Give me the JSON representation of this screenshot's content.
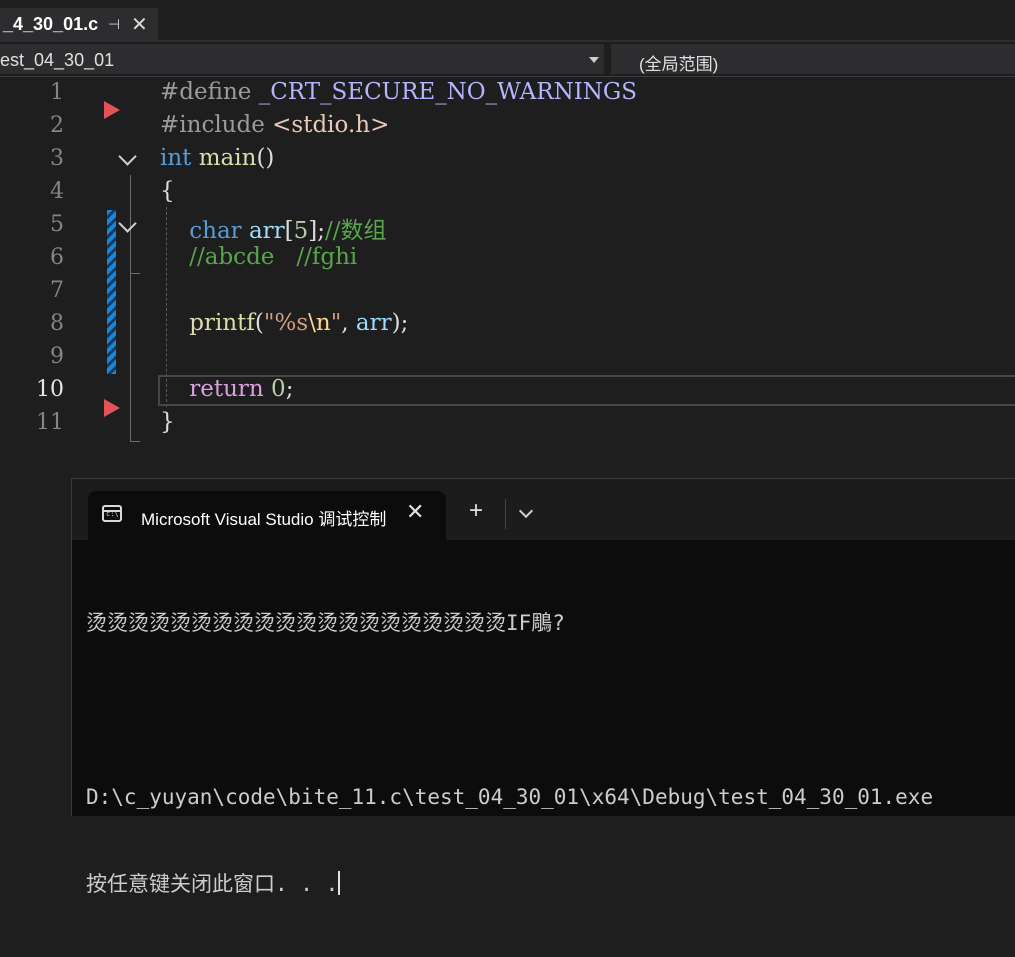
{
  "tab": {
    "title": "_4_30_01.c",
    "pin_glyph": "⊣",
    "close_glyph": "✕"
  },
  "nav": {
    "project_scope": "est_04_30_01",
    "global_scope": "(全局范围)"
  },
  "editor": {
    "line_numbers": [
      "1",
      "2",
      "3",
      "4",
      "5",
      "6",
      "7",
      "8",
      "9",
      "10",
      "11"
    ],
    "active_line": "10",
    "lines": {
      "l1_pp": "#define",
      "l1_macro": "_CRT_SECURE_NO_WARNINGS",
      "l2_pp": "#include",
      "l2_inc": "<stdio.h>",
      "l3_kw": "int",
      "l3_fn": "main",
      "l3_rest": "()",
      "l4": "{",
      "l5_kw": "char",
      "l5_var": "arr",
      "l5_open": "[",
      "l5_num": "5",
      "l5_close": "];",
      "l5_cmt": "//数组",
      "l6_cmt": "//abcde   //fghi",
      "l8_fn": "printf",
      "l8_open": "(",
      "l8_str1": "\"%s",
      "l8_esc": "\\n",
      "l8_str2": "\"",
      "l8_comma": ", ",
      "l8_var": "arr",
      "l8_close": ");",
      "l10_kw": "return",
      "l10_num": "0",
      "l10_semi": ";",
      "l11": "}"
    }
  },
  "console": {
    "tab_title": "Microsoft Visual Studio 调试控制台",
    "close_glyph": "✕",
    "new_tab_glyph": "+",
    "output": [
      "烫烫烫烫烫烫烫烫烫烫烫烫烫烫烫烫烫烫烫烫IF鵰?",
      "",
      "D:\\c_yuyan\\code\\bite_11.c\\test_04_30_01\\x64\\Debug\\test_04_30_01.exe",
      "按任意键关闭此窗口. . ."
    ]
  },
  "colors": {
    "breakpoint": "#e2535a",
    "change_bar": "#1b86d8",
    "keyword": "#569cd6",
    "comment": "#57a64a"
  }
}
